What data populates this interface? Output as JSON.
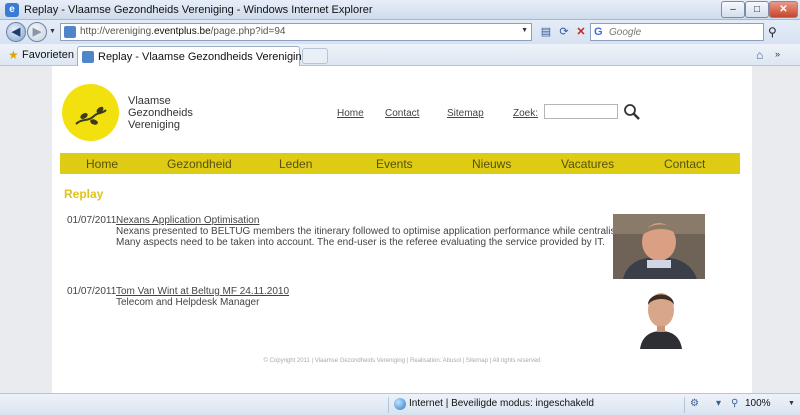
{
  "window": {
    "title": "Replay - Vlaamse Gezondheids Vereniging - Windows Internet Explorer",
    "minimize_label": "–",
    "maximize_label": "□",
    "close_label": "✕"
  },
  "address": {
    "url_prefix": "http://vereniging.",
    "url_domain": "eventplus.be",
    "url_suffix": "/page.php?id=94"
  },
  "search": {
    "placeholder": "Google"
  },
  "favorites": {
    "label": "Favorieten",
    "tab_title": "Replay - Vlaamse Gezondheids Vereniging"
  },
  "site": {
    "logo_lines": [
      "Vlaamse",
      "Gezondheids",
      "Vereniging"
    ],
    "top_links": {
      "home": "Home",
      "contact": "Contact",
      "sitemap": "Sitemap",
      "zoek": "Zoek:"
    },
    "menu": [
      "Home",
      "Gezondheid",
      "Leden",
      "Events",
      "Nieuws",
      "Vacatures",
      "Contact"
    ],
    "section_title": "Replay",
    "entries": [
      {
        "date": "01/07/2011",
        "title": "Nexans Application Optimisation",
        "desc_line1": "Nexans presented to BELTUG members the itinerary followed to optimise application performance while centralising servers.",
        "desc_line2": "Many aspects need to be taken into account. The end-user is the referee evaluating the service provided by IT."
      },
      {
        "date": "01/07/2011",
        "title": "Tom Van Wint at Beltug MF 24.11.2010",
        "desc_line1": "Telecom and Helpdesk Manager"
      }
    ],
    "footer": "© Copyright 2011 | Vlaamse Gezondheids Vereniging | Realisation: Abusol | Sitemap | All rights reserved"
  },
  "status": {
    "zone_text": "Internet | Beveiligde modus: ingeschakeld",
    "zoom": "100%"
  },
  "colors": {
    "brand_yellow": "#decb13",
    "logo_yellow": "#f3e10f",
    "title_yellow": "#e0c41c"
  }
}
